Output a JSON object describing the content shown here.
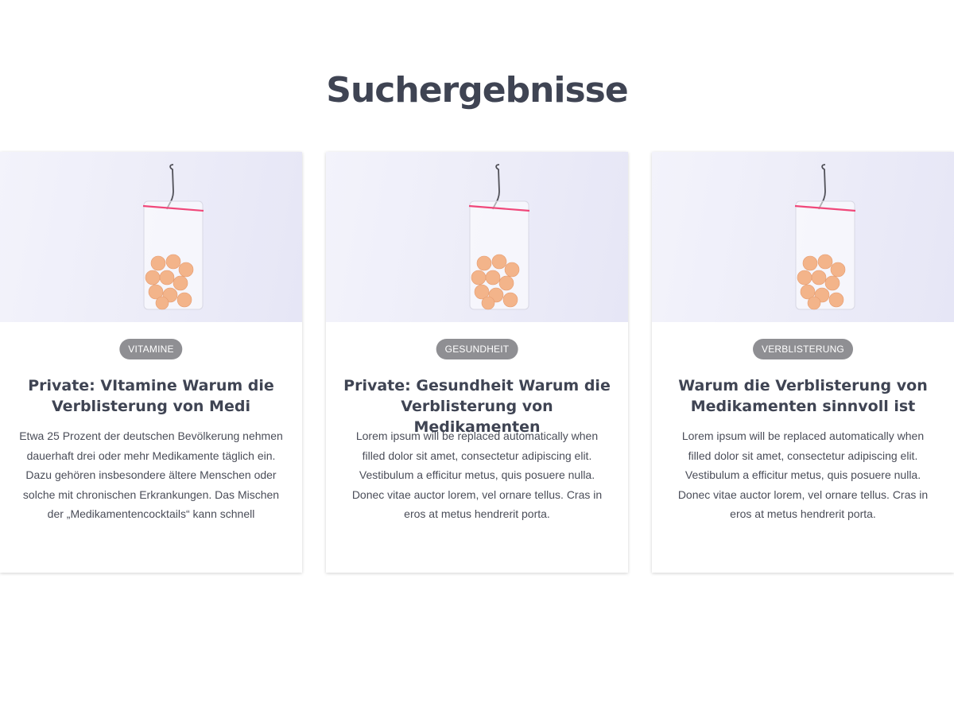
{
  "page": {
    "title": "Suchergebnisse"
  },
  "cards": [
    {
      "tag": "VITAMINE",
      "title": "Private: VItamine Warum die Verblisterung von Medi",
      "text": "Etwa 25 Prozent der deutschen Bevölkerung nehmen dauerhaft drei oder mehr Medikamente täglich ein. Dazu gehören insbesondere ältere Menschen oder solche mit chronischen Erkrankungen. Das Mischen der „Medikamentencocktails“ kann schnell",
      "image_icon": "pill-bag-image"
    },
    {
      "tag": "GESUNDHEIT",
      "title": "Private: Gesundheit Warum die Verblisterung von Medikamenten",
      "text": "Lorem ipsum will be replaced automatically when filled dolor sit amet, consectetur adipiscing elit. Vestibulum a efficitur metus, quis posuere nulla. Donec vitae auctor lorem, vel ornare tellus. Cras in eros at metus hendrerit porta.",
      "image_icon": "pill-bag-image"
    },
    {
      "tag": "VERBLISTERUNG",
      "title": "Warum die Verblisterung von Medikamenten sinnvoll ist",
      "text": "Lorem ipsum will be replaced automatically when filled dolor sit amet, consectetur adipiscing elit. Vestibulum a efficitur metus, quis posuere nulla. Donec vitae auctor lorem, vel ornare tellus. Cras in eros at metus hendrerit porta.",
      "image_icon": "pill-bag-image"
    }
  ],
  "colors": {
    "heading": "#3f4453",
    "tag_background": "#8f8f93",
    "tag_text": "#ffffff",
    "body_text": "#4a4d58",
    "image_background": "#ececf8",
    "bag_seal": "#f0487a",
    "pills": "#f3b48a"
  }
}
